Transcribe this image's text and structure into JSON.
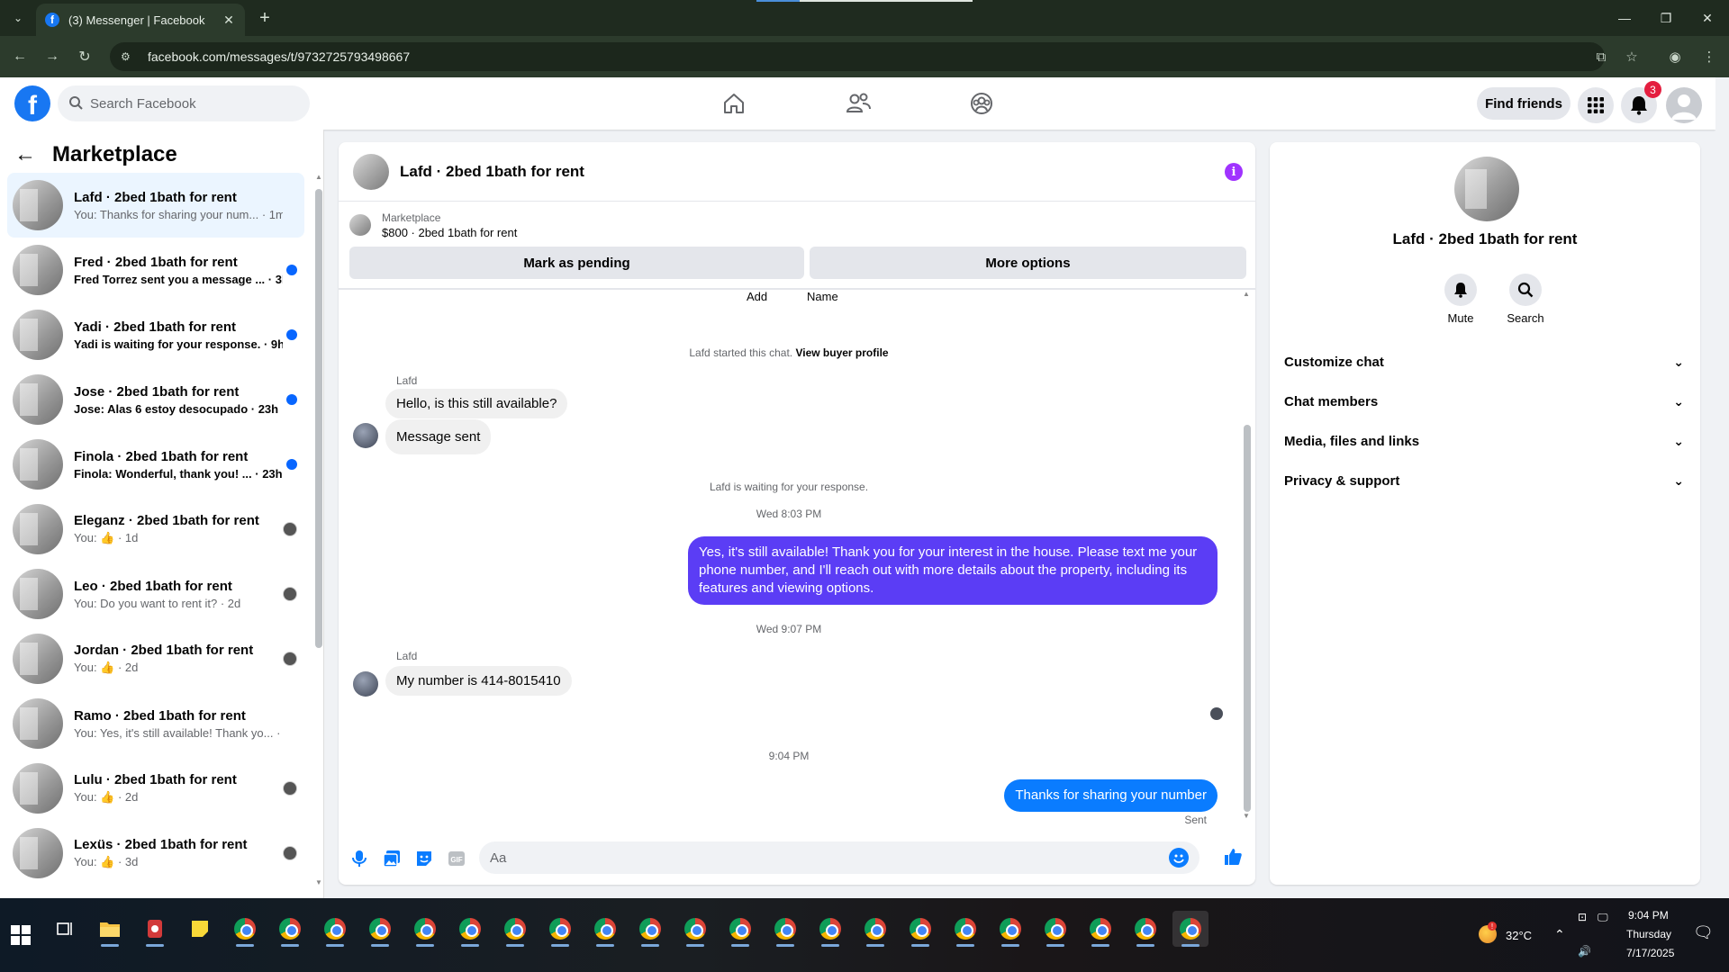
{
  "browser": {
    "tab_title": "(3) Messenger | Facebook",
    "url": "facebook.com/messages/t/9732725793498667"
  },
  "header": {
    "search_placeholder": "Search Facebook",
    "find_friends": "Find friends",
    "notification_count": "3"
  },
  "sidebar": {
    "title": "Marketplace",
    "conversations": [
      {
        "name": "Lafd · 2bed 1bath for rent",
        "preview": "You: Thanks for sharing your num... · 1m",
        "indicator": "none",
        "unread": false,
        "active": true
      },
      {
        "name": "Fred · 2bed 1bath for rent",
        "preview": "Fred Torrez sent you a message ... · 3h",
        "indicator": "dot",
        "unread": true,
        "active": false
      },
      {
        "name": "Yadi · 2bed 1bath for rent",
        "preview": "Yadi is waiting for your response. · 9h",
        "indicator": "dot",
        "unread": true,
        "active": false
      },
      {
        "name": "Jose · 2bed 1bath for rent",
        "preview": "Jose: Alas 6 estoy desocupado · 23h",
        "indicator": "dot",
        "unread": true,
        "active": false
      },
      {
        "name": "Finola · 2bed 1bath for rent",
        "preview": "Finola: Wonderful, thank you! ... · 23h",
        "indicator": "dot",
        "unread": true,
        "active": false
      },
      {
        "name": "Eleganz · 2bed 1bath for rent",
        "preview": "You: 👍 · 1d",
        "indicator": "avatar",
        "unread": false,
        "active": false
      },
      {
        "name": "Leo · 2bed 1bath for rent",
        "preview": "You: Do you want to rent it? · 2d",
        "indicator": "avatar",
        "unread": false,
        "active": false
      },
      {
        "name": "Jordan · 2bed 1bath for rent",
        "preview": "You: 👍 · 2d",
        "indicator": "avatar",
        "unread": false,
        "active": false
      },
      {
        "name": "Ramo · 2bed 1bath for rent",
        "preview": "You: Yes, it's still available! Thank yo... · 2d",
        "indicator": "none",
        "unread": false,
        "active": false
      },
      {
        "name": "Lulu · 2bed 1bath for rent",
        "preview": "You: 👍 · 2d",
        "indicator": "avatar",
        "unread": false,
        "active": false
      },
      {
        "name": "Lexüs · 2bed 1bath for rent",
        "preview": "You: 👍 · 3d",
        "indicator": "avatar",
        "unread": false,
        "active": false
      }
    ]
  },
  "chat": {
    "title": "Lafd · 2bed 1bath for rent",
    "listing_category": "Marketplace",
    "listing_price": "$800 · 2bed 1bath for rent",
    "mark_pending": "Mark as pending",
    "more_options": "More options",
    "add_label": "Add",
    "name_label": "Name",
    "started_text": "Lafd started this chat.",
    "view_profile": "View buyer profile",
    "sender1": "Lafd",
    "msg_in_1": "Hello, is this still available?",
    "msg_in_2": "Message sent",
    "waiting_text": "Lafd is waiting for your response.",
    "time_1": "Wed 8:03 PM",
    "msg_out_1": "Yes, it's still available! Thank you for your interest in the house. Please text me your phone number, and I'll reach out with more details about the property, including its features and viewing options.",
    "time_2": "Wed 9:07 PM",
    "sender2": "Lafd",
    "msg_in_3": "My number is 414-8015410",
    "time_3": "9:04 PM",
    "msg_out_2": "Thanks for sharing your number",
    "sent_label": "Sent",
    "composer_placeholder": "Aa"
  },
  "info_panel": {
    "name": "Lafd · 2bed 1bath for rent",
    "mute": "Mute",
    "search": "Search",
    "sections": [
      "Customize chat",
      "Chat members",
      "Media, files and links",
      "Privacy & support"
    ]
  },
  "taskbar": {
    "temperature": "32°C",
    "time": "9:04 PM",
    "day": "Thursday",
    "date": "7/17/2025"
  },
  "colors": {
    "fb_blue": "#1877f2",
    "outgoing_purple": "#5b3df5",
    "outgoing_blue": "#0a7cff",
    "unread_dot": "#0866ff",
    "badge_red": "#e41e3f"
  }
}
